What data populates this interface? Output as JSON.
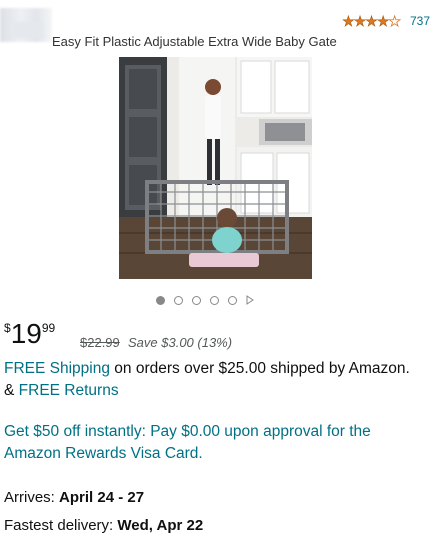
{
  "product": {
    "title": "Easy Fit Plastic Adjustable Extra Wide Baby Gate",
    "rating_stars": 4.5,
    "rating_count": "737"
  },
  "gallery": {
    "image_count": 5,
    "active_index": 0,
    "has_video": true
  },
  "price": {
    "currency": "$",
    "whole": "19",
    "fraction": "99",
    "list_price": "$22.99",
    "savings": "Save $3.00 (13%)"
  },
  "shipping": {
    "free_shipping_link": "FREE Shipping",
    "text_1": " on orders over $25.00 shipped by Amazon. & ",
    "free_returns_link": "FREE Returns"
  },
  "promo": {
    "text": "Get $50 off instantly: Pay $0.00 upon approval for the Amazon Rewards Visa Card."
  },
  "delivery": {
    "arrives_label": "Arrives: ",
    "arrives_value": "April 24 - 27",
    "fastest_label": "Fastest delivery: ",
    "fastest_value": "Wed, Apr 22"
  },
  "colors": {
    "star": "#de7921",
    "link": "#007185",
    "text": "#0f1111",
    "muted": "#565959"
  }
}
